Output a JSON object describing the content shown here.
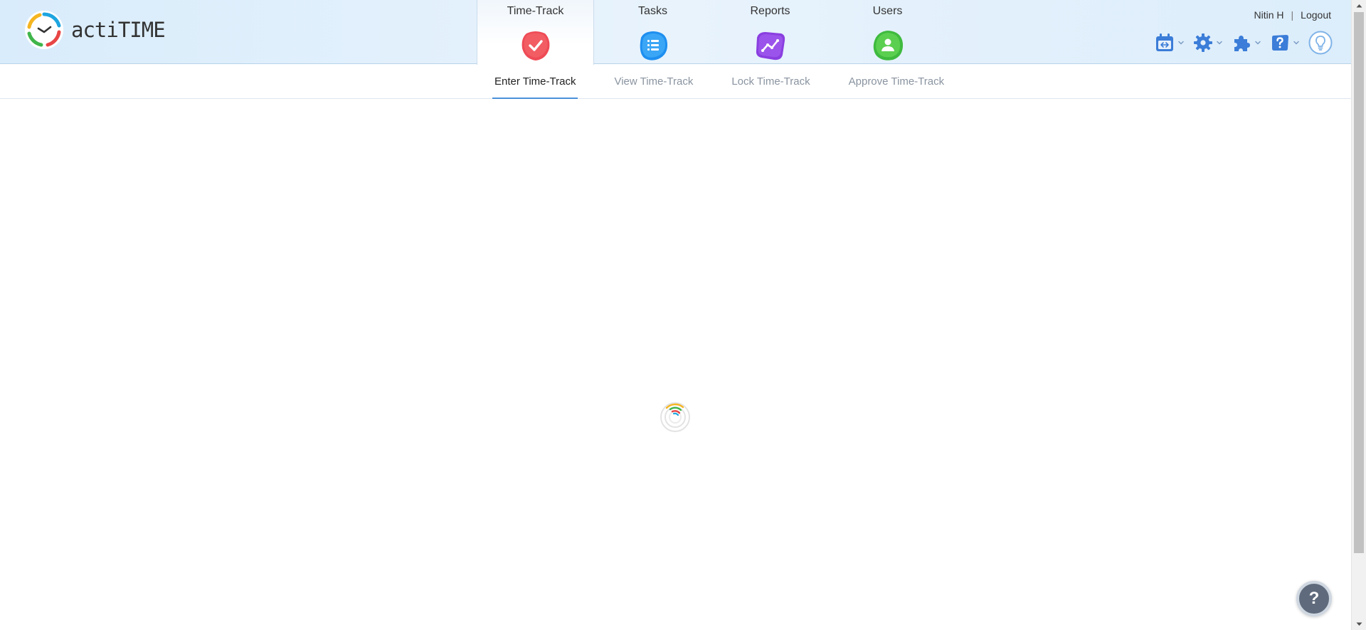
{
  "app": {
    "name": "actiTIME"
  },
  "modules": [
    {
      "label": "Time-Track",
      "icon": "check-icon",
      "color": "#ee4b56",
      "active": true
    },
    {
      "label": "Tasks",
      "icon": "list-icon",
      "color": "#1e8ff0",
      "active": false
    },
    {
      "label": "Reports",
      "icon": "chart-icon",
      "color": "#8a3fe0",
      "active": false
    },
    {
      "label": "Users",
      "icon": "user-icon",
      "color": "#3fba3f",
      "active": false
    }
  ],
  "user": {
    "name": "Nitin H",
    "separator": "|",
    "logout_label": "Logout"
  },
  "tools": [
    {
      "icon": "calendar-icon"
    },
    {
      "icon": "gear-icon"
    },
    {
      "icon": "puzzle-icon"
    },
    {
      "icon": "help-icon"
    },
    {
      "icon": "lightbulb-icon"
    }
  ],
  "sub_tabs": [
    {
      "label": "Enter Time-Track",
      "active": true
    },
    {
      "label": "View Time-Track",
      "active": false
    },
    {
      "label": "Lock Time-Track",
      "active": false
    },
    {
      "label": "Approve Time-Track",
      "active": false
    }
  ],
  "help_button": {
    "label": "?"
  },
  "colors": {
    "accent": "#4a90d9",
    "header_bg": "#dcedfb",
    "tool_icon": "#3b7dd8"
  }
}
